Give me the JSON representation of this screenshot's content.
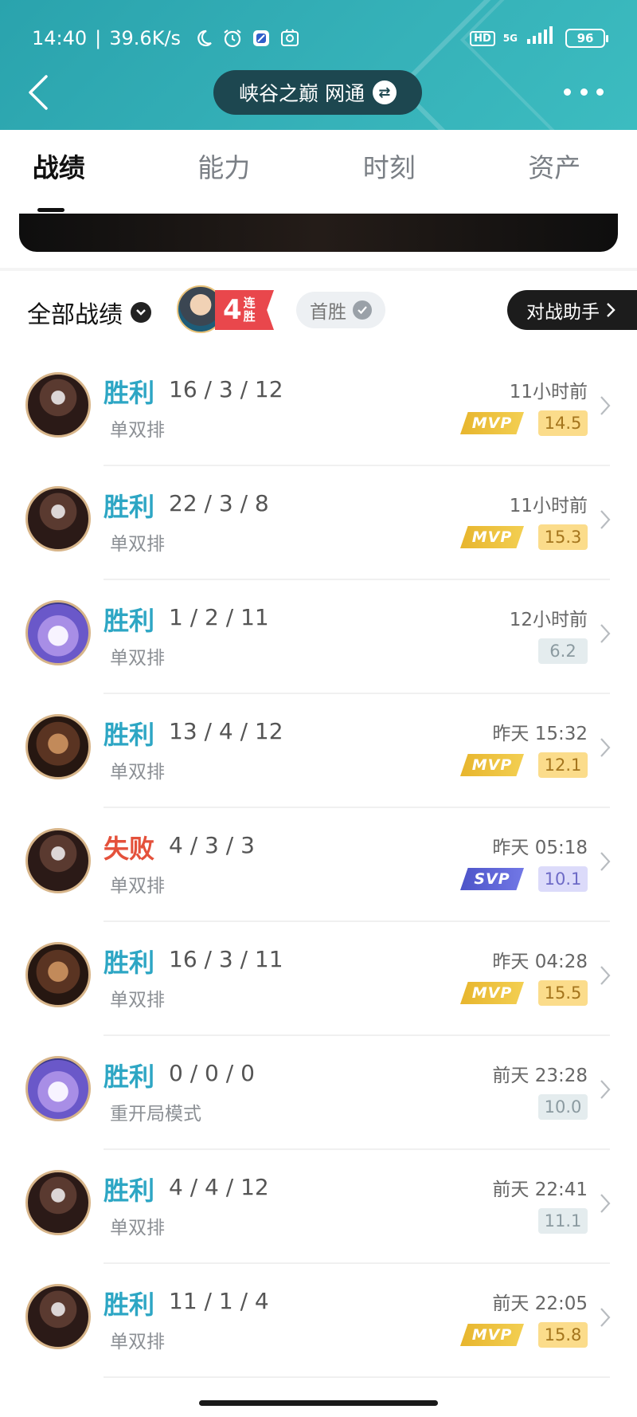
{
  "status_bar": {
    "time": "14:40",
    "separator": "|",
    "speed": "39.6K/s",
    "hd": "HD",
    "network": "5G",
    "battery": "96",
    "icons": [
      "moon-icon",
      "alarm-icon",
      "notification-app-icon",
      "game-app-icon",
      "signal-icon"
    ]
  },
  "header": {
    "server": "峡谷之巅 网通",
    "swap_icon": "⇄"
  },
  "tabs": [
    {
      "label": "战绩",
      "active": true
    },
    {
      "label": "能力",
      "active": false
    },
    {
      "label": "时刻",
      "active": false
    },
    {
      "label": "资产",
      "active": false
    }
  ],
  "filter": {
    "all_records": "全部战绩",
    "streak_num": "4",
    "streak_text": "连胜",
    "first_win": "首胜",
    "assistant": "对战助手"
  },
  "matches": [
    {
      "result": "胜利",
      "kda": "16 / 3 / 12",
      "mode": "单双排",
      "time": "11小时前",
      "badge": "MVP",
      "score": "14.5",
      "hero": "hero1"
    },
    {
      "result": "胜利",
      "kda": "22 / 3 / 8",
      "mode": "单双排",
      "time": "11小时前",
      "badge": "MVP",
      "score": "15.3",
      "hero": "hero1"
    },
    {
      "result": "胜利",
      "kda": "1 / 2 / 11",
      "mode": "单双排",
      "time": "12小时前",
      "badge": "",
      "score": "6.2",
      "hero": "hero2"
    },
    {
      "result": "胜利",
      "kda": "13 / 4 / 12",
      "mode": "单双排",
      "time": "昨天 15:32",
      "badge": "MVP",
      "score": "12.1",
      "hero": "hero3"
    },
    {
      "result": "失败",
      "kda": "4 / 3 / 3",
      "mode": "单双排",
      "time": "昨天 05:18",
      "badge": "SVP",
      "score": "10.1",
      "hero": "hero1"
    },
    {
      "result": "胜利",
      "kda": "16 / 3 / 11",
      "mode": "单双排",
      "time": "昨天 04:28",
      "badge": "MVP",
      "score": "15.5",
      "hero": "hero3"
    },
    {
      "result": "胜利",
      "kda": "0 / 0 / 0",
      "mode": "重开局模式",
      "time": "前天 23:28",
      "badge": "",
      "score": "10.0",
      "hero": "hero2"
    },
    {
      "result": "胜利",
      "kda": "4 / 4 / 12",
      "mode": "单双排",
      "time": "前天 22:41",
      "badge": "",
      "score": "11.1",
      "hero": "hero1"
    },
    {
      "result": "胜利",
      "kda": "11 / 1 / 4",
      "mode": "单双排",
      "time": "前天 22:05",
      "badge": "MVP",
      "score": "15.8",
      "hero": "hero1"
    }
  ],
  "colors": {
    "header_bg": "#36b2b9",
    "win": "#2da6c4",
    "loss": "#e4513b",
    "mvp": "#e7b52d",
    "svp": "#4c53c8"
  }
}
